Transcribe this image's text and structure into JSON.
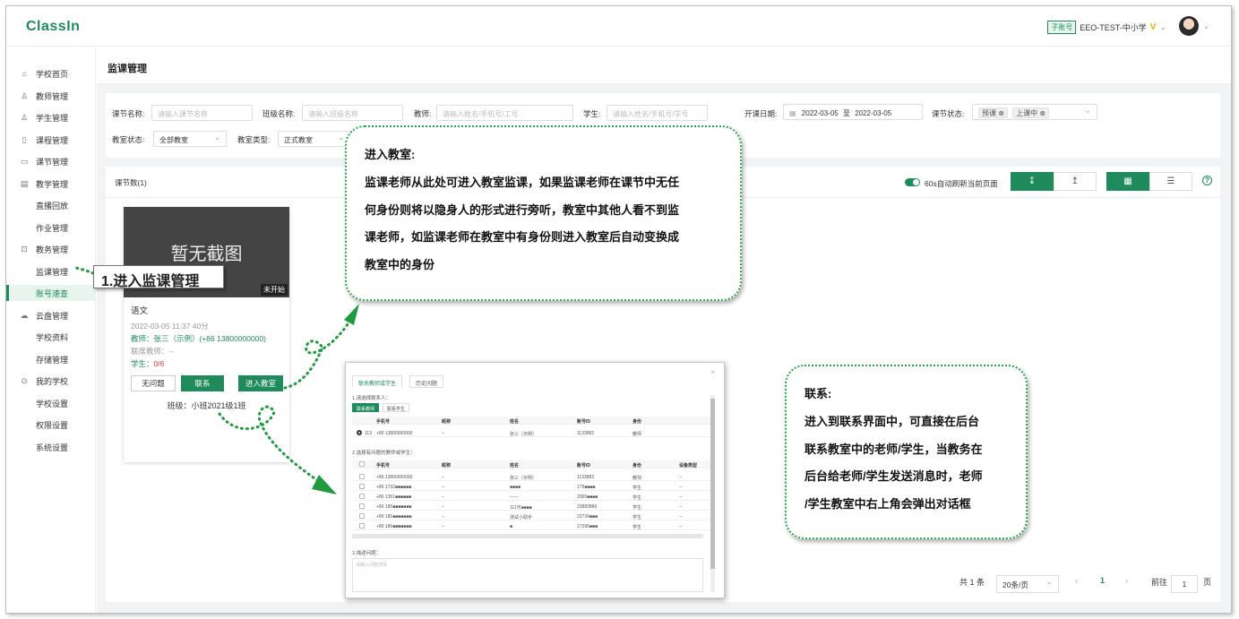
{
  "app": {
    "logo": "ClassIn"
  },
  "account": {
    "badge": "子账号",
    "org": "EEO-TEST-中小学",
    "vip": "V",
    "caret": "⌄"
  },
  "sidebar": {
    "items": [
      {
        "label": "学校首页",
        "icon": "home-icon",
        "glyph": "⌂"
      },
      {
        "label": "教师管理",
        "icon": "user-icon",
        "glyph": "♙"
      },
      {
        "label": "学生管理",
        "icon": "users-icon",
        "glyph": "♙"
      },
      {
        "label": "课程管理",
        "icon": "course-icon",
        "glyph": "▯"
      },
      {
        "label": "课节管理",
        "icon": "lesson-icon",
        "glyph": "▭"
      },
      {
        "label": "教学管理",
        "icon": "teaching-icon",
        "glyph": "▤"
      },
      {
        "label": "直播回放",
        "icon": "",
        "glyph": ""
      },
      {
        "label": "作业管理",
        "icon": "",
        "glyph": ""
      },
      {
        "label": "教务管理",
        "icon": "academic-icon",
        "glyph": "⊡"
      },
      {
        "label": "监课管理",
        "icon": "",
        "glyph": ""
      },
      {
        "label": "账号速查",
        "icon": "",
        "glyph": ""
      },
      {
        "label": "云盘管理",
        "icon": "cloud-icon",
        "glyph": "☁"
      },
      {
        "label": "学校资料",
        "icon": "",
        "glyph": ""
      },
      {
        "label": "存储管理",
        "icon": "",
        "glyph": ""
      },
      {
        "label": "我的学校",
        "icon": "school-icon",
        "glyph": "⊙"
      },
      {
        "label": "学校设置",
        "icon": "",
        "glyph": ""
      },
      {
        "label": "权限设置",
        "icon": "",
        "glyph": ""
      },
      {
        "label": "系统设置",
        "icon": "",
        "glyph": ""
      }
    ]
  },
  "page": {
    "title": "监课管理"
  },
  "filters": {
    "lesson_name_label": "课节名称:",
    "lesson_name_placeholder": "请输入课节名称",
    "class_name_label": "班级名称:",
    "class_name_placeholder": "请输入班级名称",
    "teacher_label": "教师:",
    "teacher_placeholder": "请输入姓名/手机号/工号",
    "student_label": "学生:",
    "student_placeholder": "请输入姓名/手机号/学号",
    "date_label": "开课日期:",
    "date_start": "2022-03-05",
    "date_sep": "至",
    "date_end": "2022-03-05",
    "status_label": "课节状态:",
    "status_tags": [
      "预课",
      "上课中"
    ],
    "room_status_label": "教室状态:",
    "room_status_value": "全部教室",
    "room_type_label": "教室类型:",
    "room_type_value": "正式教室"
  },
  "list": {
    "count_label": "课节数(1)",
    "auto_refresh_label": "60s自动刷新当前页面",
    "sort_desc_icon": "sort-desc-icon",
    "sort_asc_icon": "sort-asc-icon",
    "grid_view_icon": "grid-view-icon",
    "list_view_icon": "list-view-icon"
  },
  "card": {
    "thumb_text": "暂无截图",
    "status": "未开始",
    "title": "语文",
    "time": "2022-03-05 11:37 40分",
    "teacher": "教师：张三（示例）(+86 13800000000)",
    "assistant": "联席教师：--",
    "students_label": "学生：",
    "students_value": "0/6",
    "btn_no_issue": "无问题",
    "btn_contact": "联系",
    "btn_enter": "进入教室",
    "class_label": "班级：小班2021级1班"
  },
  "pagination": {
    "total": "共 1 条",
    "page_size": "20条/页",
    "prev": "‹",
    "current": "1",
    "next": "›",
    "goto_label": "前往",
    "goto_value": "1",
    "page_suffix": "页"
  },
  "callouts": {
    "step1": "1.进入监课管理",
    "enter_title": "进入教室:",
    "enter_lines": [
      "监课老师从此处可进入教室监课，如果监课老师在课节中无任",
      "何身份则将以隐身人的形式进行旁听，教室中其他人看不到监",
      "课老师，如监课老师在教室中有身份则进入教室后自动变换成",
      "教室中的身份"
    ],
    "contact_title": "联系:",
    "contact_lines": [
      "进入到联系界面中，可直接在后台",
      "联系教室中的老师/学生，当教务在",
      "后台给老师/学生发送消息时，老师",
      "/学生教室中右上角会弹出对话框"
    ]
  },
  "dialog": {
    "tab_contact": "联系教师或学生",
    "tab_history": "历史问题",
    "close": "×",
    "sec1": "1.请选择联系人：",
    "sub_teacher": "联系教师",
    "sub_student": "联系学生",
    "head1": [
      "手机号",
      "昵称",
      "姓名",
      "账号ID",
      "身份"
    ],
    "row1": [
      "113",
      "+86 13800000000",
      "--",
      "张三（示例）",
      "1133882",
      "教师"
    ],
    "sec2": "2.选择有问题的教师或学生：",
    "head2": [
      "手机号",
      "昵称",
      "姓名",
      "账号ID",
      "身份",
      "设备类型"
    ],
    "rows2": [
      [
        "+86 13800000000",
        "--",
        "张三（示例）",
        "1133882",
        "教师",
        "--"
      ],
      [
        "+86 1732■■■■■■",
        "--",
        "■■■■",
        "179■■■■",
        "学生",
        "--"
      ],
      [
        "+86 1361■■■■■■",
        "--",
        "------",
        "2065■■■■",
        "学生",
        "--"
      ],
      [
        "+86 185■■■■■■■",
        "--",
        "111可■■■■",
        "23883886",
        "学生",
        "--"
      ],
      [
        "+86 185■■■■■■■",
        "--",
        "测试小助手",
        "22734■■■",
        "学生",
        "--"
      ],
      [
        "+86 186■■■■■■■",
        "--",
        "■",
        "17396■■■",
        "学生",
        "--"
      ]
    ],
    "sec3": "3.描述问题：",
    "desc_placeholder": "请输入问题详情"
  }
}
